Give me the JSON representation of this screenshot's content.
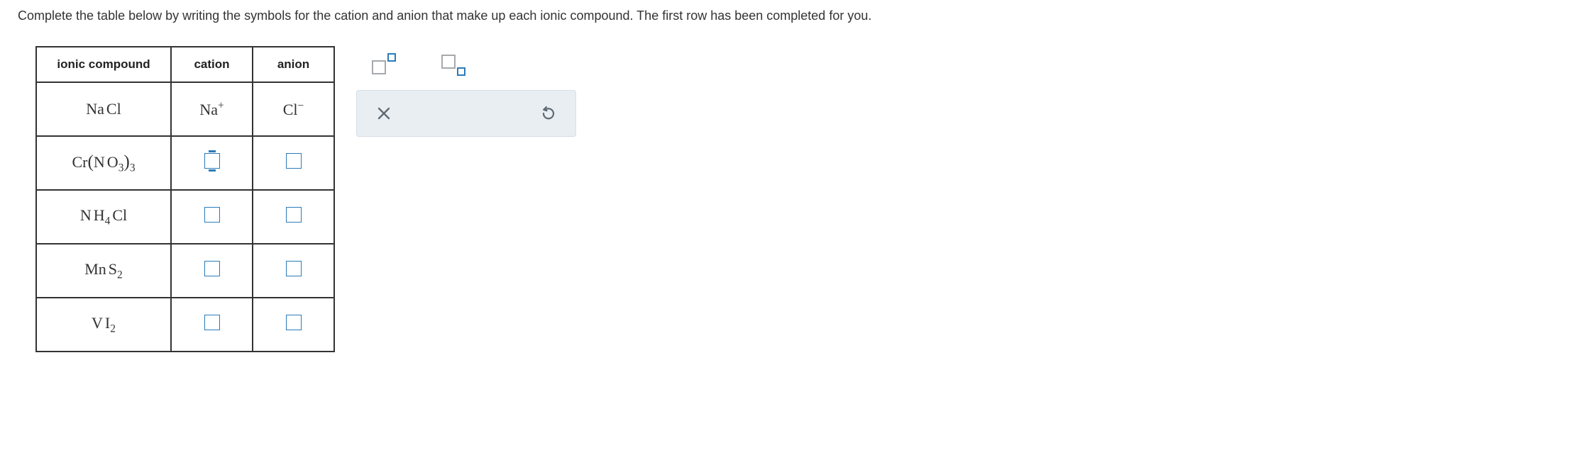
{
  "instruction": "Complete the table below by writing the symbols for the cation and anion that make up each ionic compound. The first row has been completed for you.",
  "table": {
    "headers": {
      "compound": "ionic compound",
      "cation": "cation",
      "anion": "anion"
    },
    "rows": [
      {
        "compound_html": "Na<span class='thin-space'></span>Cl",
        "cation_html": "Na<sup>+</sup>",
        "anion_html": "Cl<sup>&minus;</sup>",
        "editable": false
      },
      {
        "compound_html": "Cr<span class='big-paren'>(</span>N<span class='thin-space'></span>O<sub>3</sub><span class='big-paren'>)</span><sub>3</sub>",
        "cation_html": "",
        "anion_html": "",
        "editable": true,
        "selected": "cation"
      },
      {
        "compound_html": "N<span class='thin-space'></span>H<sub>4</sub><span class='thin-space'></span>Cl",
        "cation_html": "",
        "anion_html": "",
        "editable": true
      },
      {
        "compound_html": "Mn<span class='thin-space'></span>S<sub>2</sub>",
        "cation_html": "",
        "anion_html": "",
        "editable": true
      },
      {
        "compound_html": "V<span class='thin-space'></span>I<sub>2</sub>",
        "cation_html": "",
        "anion_html": "",
        "editable": true
      }
    ]
  },
  "tools": {
    "superscript_label": "superscript",
    "subscript_label": "subscript",
    "clear_label": "clear",
    "reset_label": "reset"
  }
}
